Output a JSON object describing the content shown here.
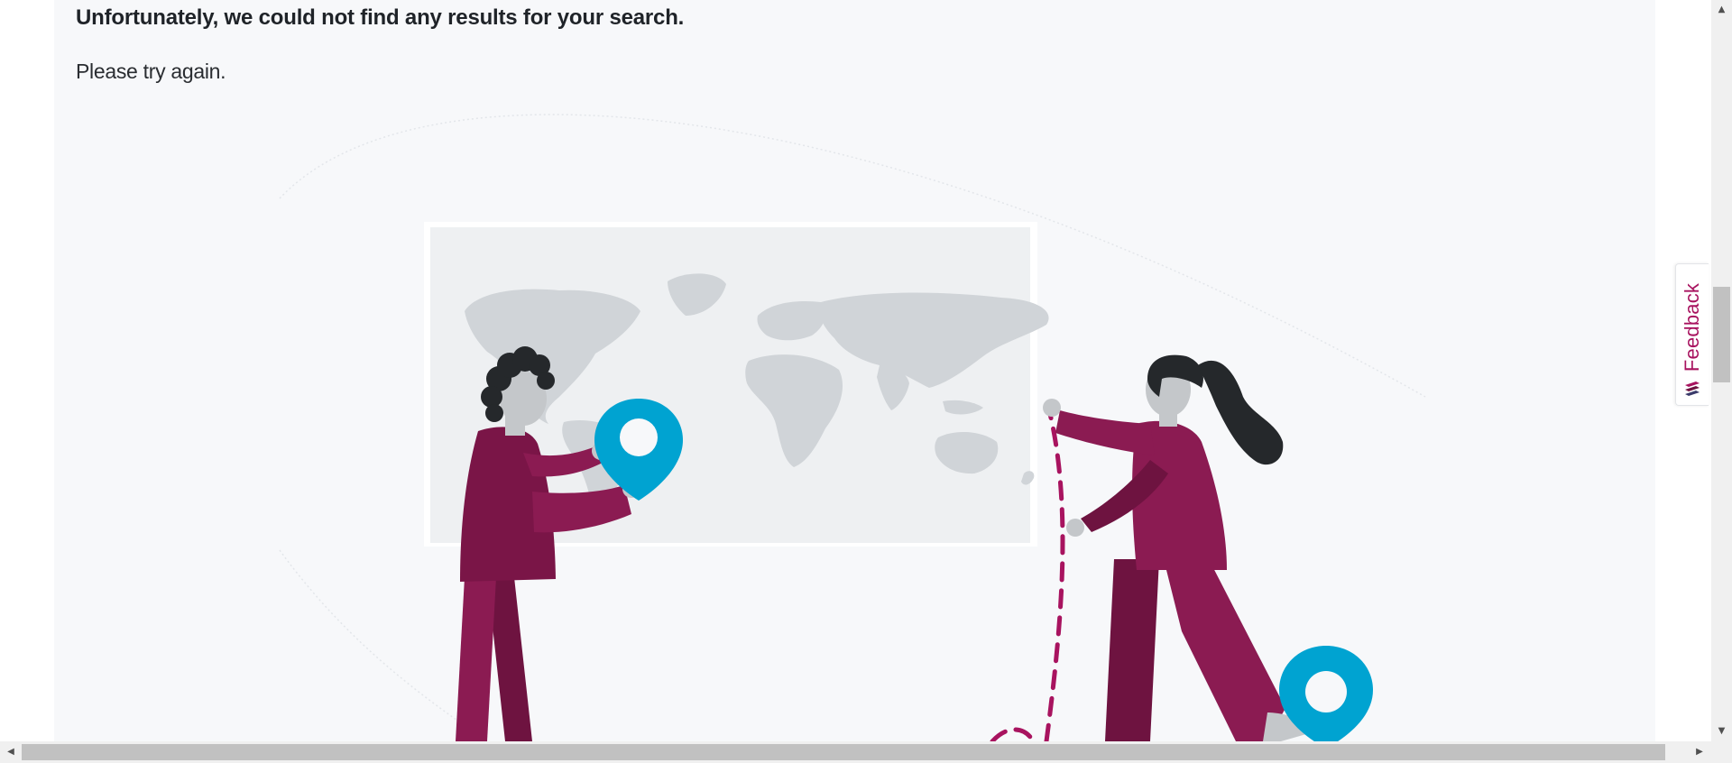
{
  "message": {
    "heading": "Unfortunately, we could not find any results for your search.",
    "subtext": "Please try again."
  },
  "illustration": {
    "subject": "two people placing location pins on a world map",
    "colors": {
      "panel_background": "#f7f8fa",
      "map_board": "#eef0f2",
      "continents": "#d0d4d8",
      "clothing": "#8b1b52",
      "clothing_dark": "#6e1340",
      "pin": "#00a3d1",
      "hair": "#25282b",
      "skin": "#c4c7ca",
      "dashed_path": "#a8135f"
    }
  },
  "feedback": {
    "label": "Feedback",
    "color": "#a8135f",
    "icon": "feedback-logo-icon"
  },
  "scrollbars": {
    "up_icon": "scroll-up-arrow-icon",
    "down_icon": "scroll-down-arrow-icon",
    "left_icon": "scroll-left-arrow-icon",
    "right_icon": "scroll-right-arrow-icon"
  }
}
